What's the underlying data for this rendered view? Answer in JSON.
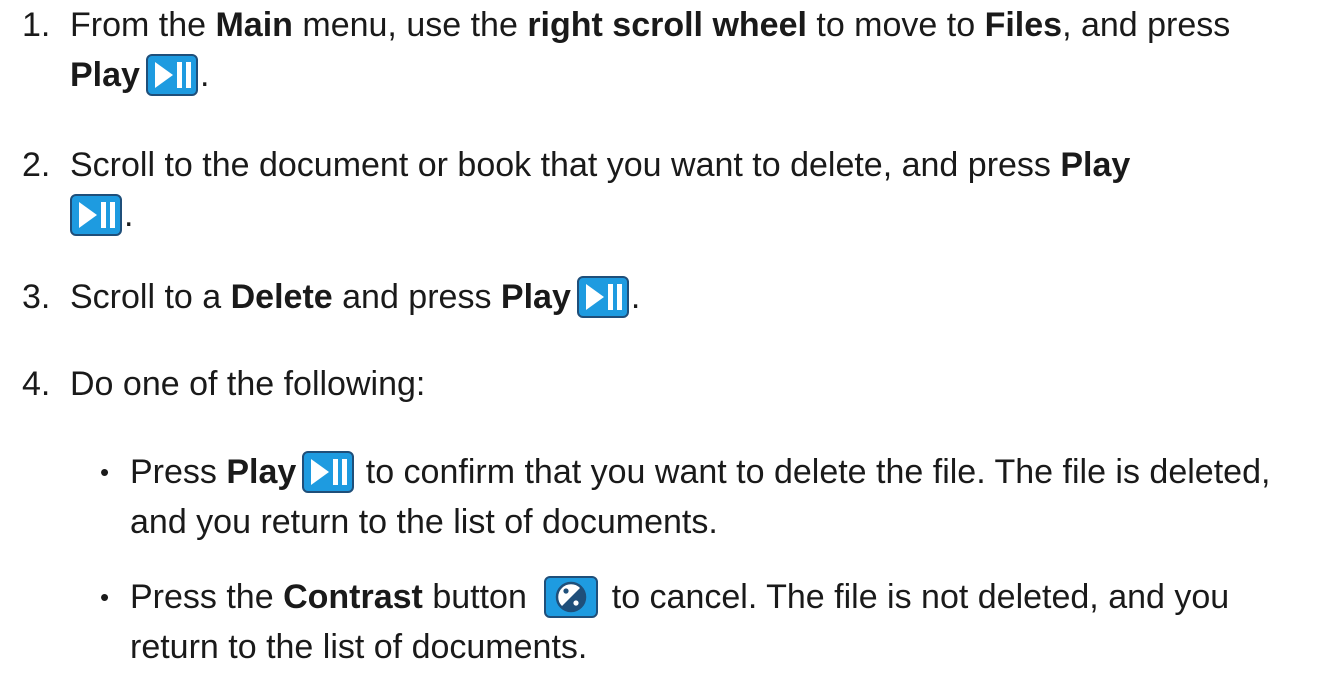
{
  "steps": [
    {
      "number": "1.",
      "parts": [
        "From the ",
        "Main",
        " menu, use the ",
        "right scroll wheel",
        " to move to ",
        "Files",
        ", and press ",
        "Play",
        "."
      ]
    },
    {
      "number": "2.",
      "parts": [
        "Scroll to the document or book that you want to delete, and press ",
        "Play",
        "."
      ]
    },
    {
      "number": "3.",
      "parts": [
        "Scroll to a ",
        "Delete",
        " and press ",
        "Play",
        "."
      ]
    },
    {
      "number": "4.",
      "parts": [
        "Do one of the following:"
      ]
    }
  ],
  "bullets": [
    {
      "marker": "•",
      "parts": [
        "Press ",
        "Play",
        " to confirm that you want to delete the file. The file is deleted, and you return to the list of documents."
      ]
    },
    {
      "marker": "•",
      "parts": [
        "Press the ",
        "Contrast",
        " button ",
        " to cancel. The file is not deleted, and you return to the list of documents."
      ]
    }
  ],
  "icons": {
    "play": "play-pause-icon",
    "contrast": "contrast-icon",
    "accent_color": "#1e9be0",
    "border_color": "#1f4f7a"
  }
}
